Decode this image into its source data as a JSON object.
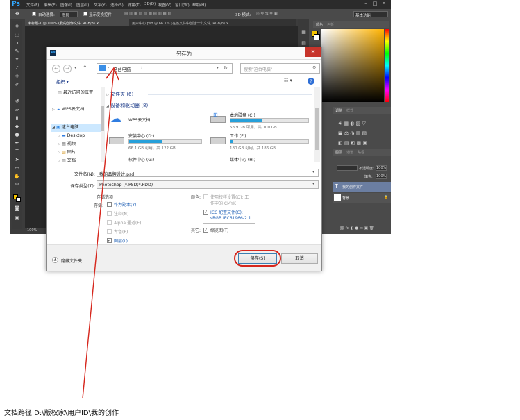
{
  "ps": {
    "logo": "Ps",
    "menu": [
      "文件(F)",
      "编辑(E)",
      "图像(I)",
      "图层(L)",
      "文字(Y)",
      "选择(S)",
      "滤镜(T)",
      "3D(D)",
      "视图(V)",
      "窗口(W)",
      "帮助(H)"
    ],
    "options": {
      "auto_select": "自动选择:",
      "layer_value": "图层",
      "show_transform": "显示变换控件",
      "mode_3d": "3D 模式:",
      "workspace": "基本功能"
    },
    "tabs": [
      "未标题-1 @ 100% (我的创作文件, RGB/8) ×",
      "用户中心.psd @ 66.7% (在该文件中创建一个文件, RGB/8) ×"
    ],
    "status_zoom": "100%",
    "panels": {
      "color_tab": "颜色",
      "swatches_tab": "色板",
      "adjust_tab": "调整",
      "style_tab": "样式",
      "layers_tab": "图层",
      "channels_tab": "通道",
      "paths_tab": "路径",
      "opacity_label": "不透明度:",
      "opacity_value": "100%",
      "fill_label": "填充:",
      "fill_value": "100%",
      "layer_text": "我的创作文件",
      "layer_bg": "背景"
    }
  },
  "dialog": {
    "title": "另存为",
    "ps_icon": "Ps",
    "close_glyph": "✕",
    "breadcrumb": [
      "这台电脑"
    ],
    "search_placeholder": "搜索\"这台电脑\"",
    "organize": "组织 ▾",
    "nav": {
      "recent": "最近访问的位置",
      "wps": "WPS云文档",
      "this_pc": "这台电脑",
      "desktop": "Desktop",
      "videos": "视频",
      "pictures": "图片",
      "documents": "文档"
    },
    "folders_header": "文件夹 (6)",
    "devices_header": "设备和驱动器 (8)",
    "drives": [
      {
        "name": "WPS云文档",
        "sub": "",
        "fill": 0
      },
      {
        "name": "本地磁盘 (C:)",
        "sub": "58.9 GB 可用，共 100 GB",
        "fill": 0.41
      },
      {
        "name": "安装中心 (D:)",
        "sub": "66.1 GB 可用，共 122 GB",
        "fill": 0.46
      },
      {
        "name": "工作 (F:)",
        "sub": "180 GB 可用，共 186 GB",
        "fill": 0.03
      },
      {
        "name": "软件中心 (G:)",
        "sub": "",
        "fill": 0
      },
      {
        "name": "媒体中心 (H:)",
        "sub": "",
        "fill": 0
      }
    ],
    "filename_label": "文件名(N):",
    "filename_value": "我的品牌设计.psd",
    "filetype_label": "保存类型(T):",
    "filetype_value": "Photoshop (*.PSD;*.PDD)",
    "save_options_title": "存储选项",
    "store_label": "存储:",
    "opt_copy": "作为副本(Y)",
    "opt_notes": "注释(N)",
    "opt_alpha": "Alpha 通道(E)",
    "opt_spot": "专色(P)",
    "opt_layers": "图层(L)",
    "color_label": "颜色:",
    "opt_proof_1": "使用校样设置(O): 工",
    "opt_proof_2": "作中的 CMYK",
    "opt_icc_1": "ICC 配置文件(C):",
    "opt_icc_2": "sRGB IEC61966-2.1",
    "other_label": "其它:",
    "opt_thumb": "缩览图(T)",
    "hide_folders": "隐藏文件夹",
    "save_button": "保存(S)",
    "cancel_button": "取消"
  },
  "caption": "文档路径   D:\\版权家\\用户ID\\我的创作",
  "colors": {
    "annotation_red": "#d6261c",
    "ps_dark": "#3c3c3c",
    "accent_blue": "#26a0da"
  }
}
